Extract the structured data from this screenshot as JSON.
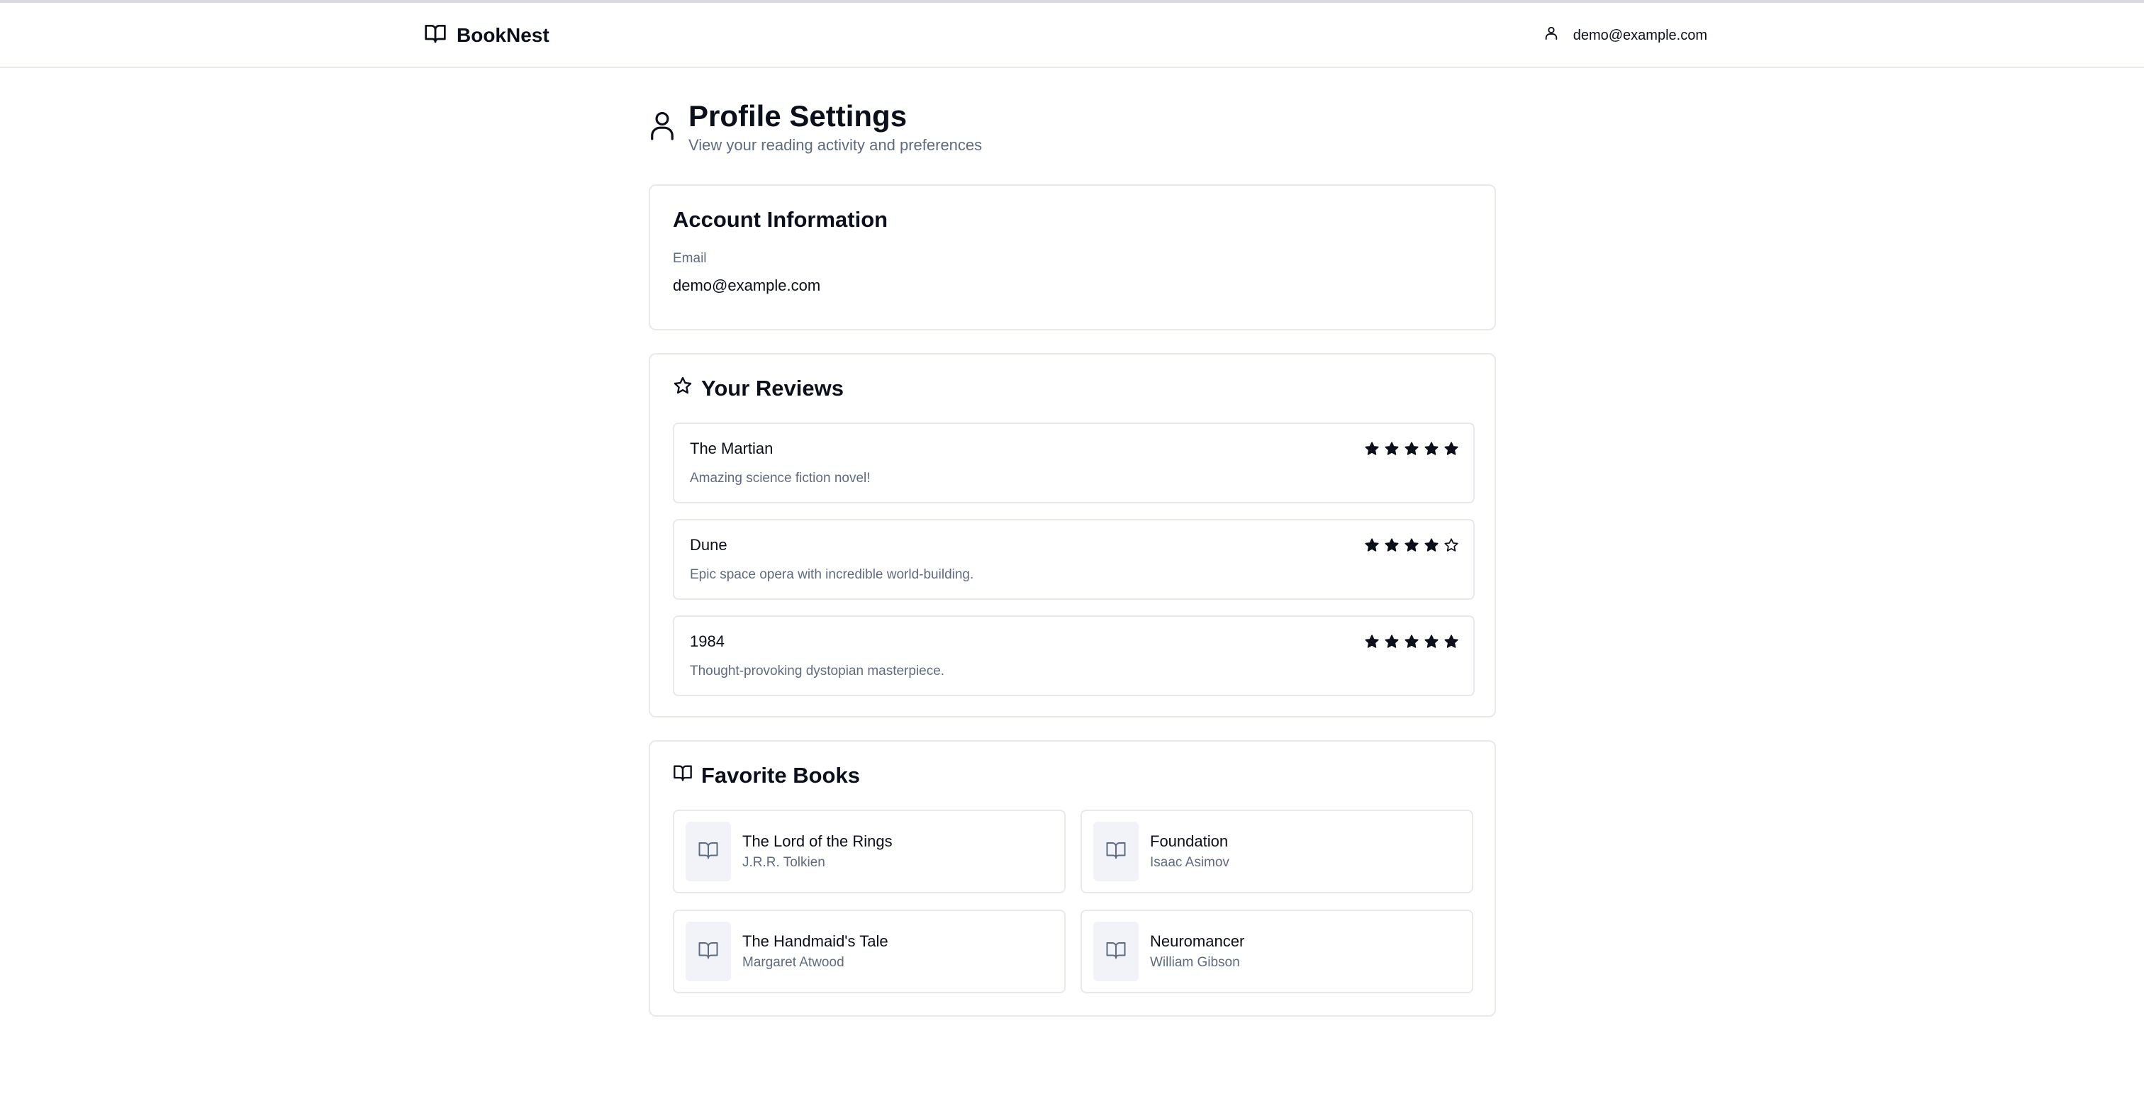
{
  "app": {
    "brand": "BookNest",
    "user_email": "demo@example.com"
  },
  "page": {
    "title": "Profile Settings",
    "subtitle": "View your reading activity and preferences"
  },
  "account": {
    "heading": "Account Information",
    "email_label": "Email",
    "email_value": "demo@example.com"
  },
  "reviews": {
    "heading": "Your Reviews",
    "items": [
      {
        "book": "The Martian",
        "comment": "Amazing science fiction novel!",
        "rating": 5,
        "max": 5
      },
      {
        "book": "Dune",
        "comment": "Epic space opera with incredible world-building.",
        "rating": 4,
        "max": 5
      },
      {
        "book": "1984",
        "comment": "Thought-provoking dystopian masterpiece.",
        "rating": 5,
        "max": 5
      }
    ]
  },
  "favorites": {
    "heading": "Favorite Books",
    "items": [
      {
        "title": "The Lord of the Rings",
        "author": "J.R.R. Tolkien"
      },
      {
        "title": "Foundation",
        "author": "Isaac Asimov"
      },
      {
        "title": "The Handmaid's Tale",
        "author": "Margaret Atwood"
      },
      {
        "title": "Neuromancer",
        "author": "William Gibson"
      }
    ]
  },
  "icons": {
    "brand": "book-open-icon",
    "user": "user-icon",
    "reviews": "star-icon",
    "favorites": "book-open-icon"
  },
  "colors": {
    "text": "#0b0f1a",
    "muted": "#5f6b80",
    "border": "#e7e9ee",
    "thumb_bg": "#f1f3f8"
  }
}
